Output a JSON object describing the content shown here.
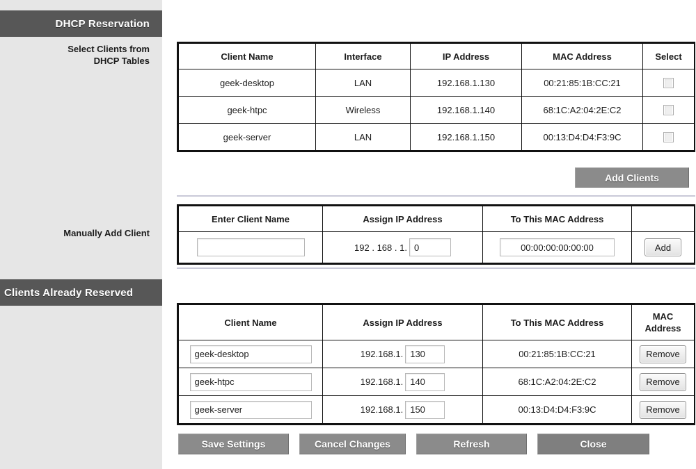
{
  "sidebar": {
    "section_dhcp_title": "DHCP Reservation",
    "section_reserved_title": "Clients Already Reserved",
    "label_select_clients_line1": "Select Clients from",
    "label_select_clients_line2": "DHCP Tables",
    "label_manually_add": "Manually Add Client"
  },
  "dhcp_table": {
    "headers": [
      "Client Name",
      "Interface",
      "IP Address",
      "MAC Address",
      "Select"
    ],
    "rows": [
      {
        "client_name": "geek-desktop",
        "interface": "LAN",
        "ip": "192.168.1.130",
        "mac": "00:21:85:1B:CC:21",
        "selected": false
      },
      {
        "client_name": "geek-htpc",
        "interface": "Wireless",
        "ip": "192.168.1.140",
        "mac": "68:1C:A2:04:2E:C2",
        "selected": false
      },
      {
        "client_name": "geek-server",
        "interface": "LAN",
        "ip": "192.168.1.150",
        "mac": "00:13:D4:D4:F3:9C",
        "selected": false
      }
    ]
  },
  "add_clients_button": "Add Clients",
  "manual_table": {
    "headers": [
      "Enter Client Name",
      "Assign IP Address",
      "To This MAC Address",
      ""
    ],
    "row": {
      "client_name_value": "",
      "client_name_placeholder": "",
      "ip_prefix": "192 . 168 . 1.",
      "ip_last_octet": "0",
      "mac_value": "00:00:00:00:00:00",
      "add_button": "Add"
    }
  },
  "reserved_table": {
    "headers": [
      "Client Name",
      "Assign IP Address",
      "To This MAC Address",
      "MAC Address"
    ],
    "header_mac_line1": "MAC",
    "header_mac_line2": "Address",
    "rows": [
      {
        "client_name": "geek-desktop",
        "ip_prefix": "192.168.1.",
        "ip_last_octet": "130",
        "mac": "00:21:85:1B:CC:21",
        "remove_label": "Remove"
      },
      {
        "client_name": "geek-htpc",
        "ip_prefix": "192.168.1.",
        "ip_last_octet": "140",
        "mac": "68:1C:A2:04:2E:C2",
        "remove_label": "Remove"
      },
      {
        "client_name": "geek-server",
        "ip_prefix": "192.168.1.",
        "ip_last_octet": "150",
        "mac": "00:13:D4:D4:F3:9C",
        "remove_label": "Remove"
      }
    ]
  },
  "footer_buttons": {
    "save": "Save Settings",
    "cancel": "Cancel Changes",
    "refresh": "Refresh",
    "close": "Close"
  },
  "colors": {
    "section_header_bg": "#575757",
    "sidebar_bg": "#e6e6e6",
    "button_gray": "#8b8b8b",
    "button_close_gray": "#7f7f7f",
    "divider": "#c9c9d8",
    "table_border": "#111111"
  }
}
